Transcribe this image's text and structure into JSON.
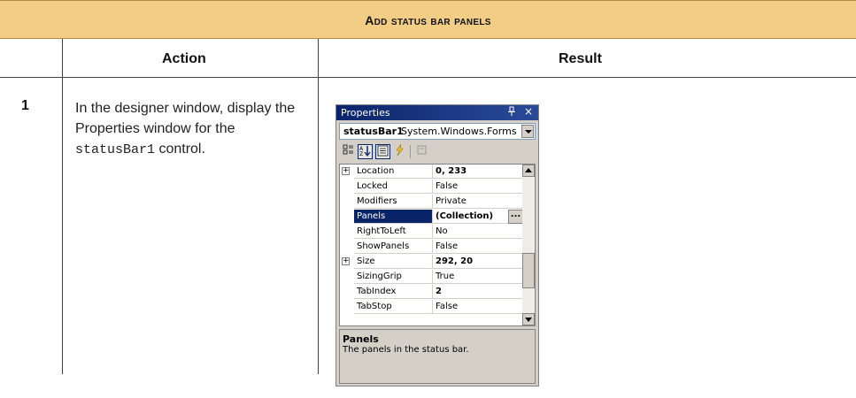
{
  "banner": {
    "title": "Add status bar panels"
  },
  "table": {
    "headers": {
      "action": "Action",
      "result": "Result"
    },
    "step": {
      "number": "1",
      "action_text": "In the designer window, display the Properties window for the ",
      "action_code": "statusBar1",
      "action_suffix": " control."
    }
  },
  "properties_window": {
    "title": "Properties",
    "pin_glyph": "q",
    "close_glyph": "×",
    "object_name": "statusBar1",
    "object_type": "System.Windows.Forms",
    "toolbar_icons": [
      "categorized-icon",
      "alphabetical-icon",
      "properties-icon",
      "events-icon",
      "property-pages-icon"
    ],
    "rows": [
      {
        "name": "Location",
        "value": "0, 233",
        "expandable": true,
        "bold": true,
        "selected": false
      },
      {
        "name": "Locked",
        "value": "False",
        "expandable": false,
        "bold": false,
        "selected": false
      },
      {
        "name": "Modifiers",
        "value": "Private",
        "expandable": false,
        "bold": false,
        "selected": false
      },
      {
        "name": "Panels",
        "value": "(Collection)",
        "expandable": false,
        "bold": true,
        "selected": true
      },
      {
        "name": "RightToLeft",
        "value": "No",
        "expandable": false,
        "bold": false,
        "selected": false
      },
      {
        "name": "ShowPanels",
        "value": "False",
        "expandable": false,
        "bold": false,
        "selected": false
      },
      {
        "name": "Size",
        "value": "292, 20",
        "expandable": true,
        "bold": true,
        "selected": false
      },
      {
        "name": "SizingGrip",
        "value": "True",
        "expandable": false,
        "bold": false,
        "selected": false
      },
      {
        "name": "TabIndex",
        "value": "2",
        "expandable": false,
        "bold": true,
        "selected": false
      },
      {
        "name": "TabStop",
        "value": "False",
        "expandable": false,
        "bold": false,
        "selected": false
      }
    ],
    "ellipsis_label": "...",
    "description": {
      "title": "Panels",
      "text": "The panels in the status bar."
    },
    "colors": {
      "titlebar": "#0a246a",
      "selection": "#0a246a",
      "chrome": "#d4d0c8"
    }
  },
  "colors": {
    "banner": "#f2cd86"
  }
}
